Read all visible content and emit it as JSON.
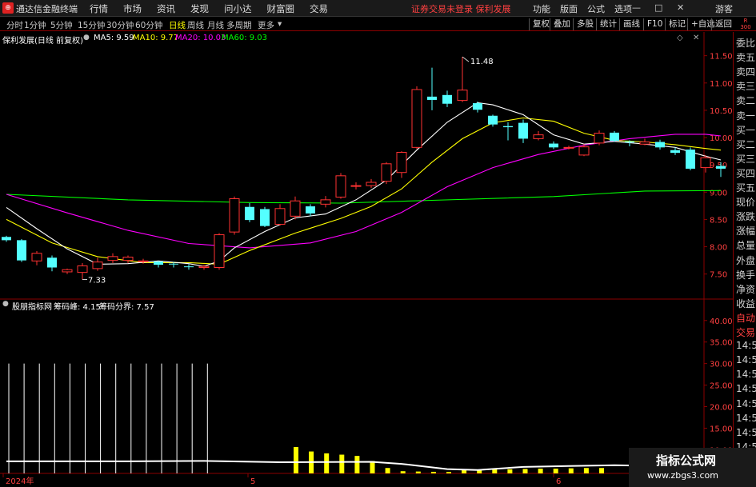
{
  "app": {
    "logo": "⊕",
    "title": "通达信金融终端",
    "menu": [
      "行情",
      "市场",
      "资讯",
      "发现",
      "问小达",
      "财富圈",
      "交易"
    ],
    "warning": "证券交易未登录  保利发展",
    "right_menu": [
      "功能",
      "版面",
      "公式",
      "选项"
    ],
    "window_buttons": [
      "—",
      "□",
      "✕"
    ],
    "user": "游客"
  },
  "periods": {
    "items": [
      "分时",
      "1分钟",
      "5分钟",
      "15分钟",
      "30分钟",
      "60分钟",
      "日线",
      "周线",
      "月线",
      "多周期",
      "更多"
    ],
    "active": "日线",
    "tools": [
      "复权",
      "叠加",
      "多股",
      "统计",
      "画线",
      "F10",
      "标记",
      "+自选",
      "返回"
    ],
    "badge_top": "R",
    "badge_bottom": "300"
  },
  "main_info": {
    "title": "保利发展(日线 前复权)",
    "ma5": "MA5: 9.59",
    "ma10": "MA10: 9.77",
    "ma20": "MA20: 10.03",
    "ma60": "MA60: 9.03"
  },
  "sub_info": {
    "title": "股朋指标网",
    "peak": "筹码峰: 4.15",
    "boundary": "筹码分界: 7.57"
  },
  "side_panel": [
    "委比",
    "卖五",
    "卖四",
    "卖三",
    "卖二",
    "卖一",
    "买一",
    "买二",
    "买三",
    "买四",
    "买五",
    "现价",
    "涨跌",
    "涨幅",
    "总量",
    "外盘",
    "换手",
    "净资",
    "收益",
    "自动",
    "交易",
    "14:5",
    "14:5",
    "14:5",
    "14:5",
    "14:5",
    "14:5",
    "14:5",
    "14:5",
    "14:5"
  ],
  "watermark": {
    "line1": "指标公式网",
    "line2": "www.zbgs3.com"
  },
  "colors": {
    "up": "#ff3232",
    "down": "#54ffff",
    "ma5": "#ffffff",
    "ma10": "#ffff00",
    "ma20": "#ff00ff",
    "ma60": "#00ff00",
    "axis": "#8b0000",
    "warning": "#ff4040"
  },
  "chart_data": [
    {
      "type": "candlestick",
      "title": "保利发展(日线 前复权)",
      "y_ticks": [
        "11.50",
        "11.00",
        "10.50",
        "10.00",
        "9.50",
        "9.00",
        "8.50",
        "8.00",
        "7.50"
      ],
      "ylim": [
        7.1,
        11.7
      ],
      "x_labels": [
        "2024年",
        "5",
        "6"
      ],
      "annotations": [
        "11.48",
        "7.33"
      ],
      "candles": [
        [
          8.18,
          8.12,
          8.2,
          8.09
        ],
        [
          8.12,
          7.75,
          8.14,
          7.72
        ],
        [
          7.74,
          7.88,
          7.92,
          7.66
        ],
        [
          7.8,
          7.62,
          7.84,
          7.55
        ],
        [
          7.54,
          7.58,
          7.6,
          7.5
        ],
        [
          7.53,
          7.65,
          7.7,
          7.4
        ],
        [
          7.6,
          7.72,
          7.8,
          7.56
        ],
        [
          7.75,
          7.82,
          7.88,
          7.7
        ],
        [
          7.75,
          7.81,
          7.84,
          7.7
        ],
        [
          7.73,
          7.74,
          7.78,
          7.69
        ],
        [
          7.73,
          7.67,
          7.74,
          7.62
        ],
        [
          7.69,
          7.68,
          7.72,
          7.62
        ],
        [
          7.64,
          7.63,
          7.68,
          7.58
        ],
        [
          7.62,
          7.64,
          7.67,
          7.58
        ],
        [
          7.62,
          8.22,
          8.25,
          7.58
        ],
        [
          8.27,
          8.88,
          8.92,
          8.22
        ],
        [
          8.73,
          8.49,
          8.8,
          8.45
        ],
        [
          8.69,
          8.38,
          8.73,
          8.36
        ],
        [
          8.41,
          8.7,
          8.78,
          8.39
        ],
        [
          8.56,
          8.84,
          8.92,
          8.5
        ],
        [
          8.74,
          8.61,
          8.78,
          8.56
        ],
        [
          8.78,
          8.86,
          8.93,
          8.72
        ],
        [
          8.91,
          9.3,
          9.35,
          8.88
        ],
        [
          9.11,
          9.12,
          9.18,
          9.05
        ],
        [
          9.12,
          9.18,
          9.24,
          9.08
        ],
        [
          9.2,
          9.52,
          9.55,
          9.15
        ],
        [
          9.36,
          9.73,
          9.75,
          9.26
        ],
        [
          9.82,
          10.88,
          10.94,
          9.79
        ],
        [
          10.75,
          10.69,
          11.28,
          10.5
        ],
        [
          10.78,
          10.62,
          10.86,
          10.56
        ],
        [
          10.68,
          10.87,
          11.48,
          10.65
        ],
        [
          10.63,
          10.51,
          10.66,
          10.46
        ],
        [
          10.4,
          10.24,
          10.42,
          10.2
        ],
        [
          10.21,
          10.19,
          10.28,
          9.95
        ],
        [
          10.27,
          9.98,
          10.33,
          9.9
        ],
        [
          9.98,
          10.05,
          10.12,
          9.95
        ],
        [
          9.89,
          9.82,
          9.93,
          9.79
        ],
        [
          9.82,
          9.82,
          9.85,
          9.78
        ],
        [
          9.68,
          9.83,
          9.88,
          9.66
        ],
        [
          9.9,
          10.08,
          10.13,
          9.86
        ],
        [
          10.09,
          9.94,
          10.12,
          9.92
        ],
        [
          9.93,
          9.91,
          9.95,
          9.84
        ],
        [
          9.88,
          9.92,
          9.98,
          9.86
        ],
        [
          9.92,
          9.82,
          9.96,
          9.78
        ],
        [
          9.77,
          9.72,
          9.82,
          9.68
        ],
        [
          9.78,
          9.43,
          9.82,
          9.4
        ],
        [
          9.45,
          9.63,
          9.68,
          9.36
        ],
        [
          9.48,
          9.43,
          9.55,
          9.28
        ]
      ],
      "ma5": [
        [
          0,
          8.72
        ],
        [
          2,
          8.33
        ],
        [
          4,
          7.96
        ],
        [
          6,
          7.68
        ],
        [
          8,
          7.69
        ],
        [
          10,
          7.74
        ],
        [
          12,
          7.69
        ],
        [
          13,
          7.64
        ],
        [
          14,
          7.74
        ],
        [
          15,
          7.98
        ],
        [
          17,
          8.28
        ],
        [
          19,
          8.53
        ],
        [
          21,
          8.6
        ],
        [
          23,
          8.86
        ],
        [
          25,
          9.22
        ],
        [
          27,
          9.77
        ],
        [
          29,
          10.28
        ],
        [
          31,
          10.64
        ],
        [
          32,
          10.6
        ],
        [
          34,
          10.42
        ],
        [
          36,
          10.05
        ],
        [
          38,
          9.88
        ],
        [
          40,
          9.93
        ],
        [
          42,
          9.88
        ],
        [
          44,
          9.82
        ],
        [
          46,
          9.66
        ],
        [
          47,
          9.59
        ]
      ],
      "ma10": [
        [
          0,
          8.5
        ],
        [
          3,
          8.07
        ],
        [
          6,
          7.82
        ],
        [
          9,
          7.71
        ],
        [
          12,
          7.71
        ],
        [
          14,
          7.68
        ],
        [
          16,
          7.93
        ],
        [
          19,
          8.25
        ],
        [
          22,
          8.52
        ],
        [
          24,
          8.74
        ],
        [
          26,
          9.06
        ],
        [
          28,
          9.55
        ],
        [
          30,
          9.98
        ],
        [
          32,
          10.27
        ],
        [
          34,
          10.36
        ],
        [
          36,
          10.3
        ],
        [
          38,
          10.08
        ],
        [
          40,
          9.95
        ],
        [
          42,
          9.92
        ],
        [
          44,
          9.87
        ],
        [
          46,
          9.8
        ],
        [
          47,
          9.77
        ]
      ],
      "ma20": [
        [
          0,
          8.96
        ],
        [
          4,
          8.62
        ],
        [
          8,
          8.3
        ],
        [
          12,
          8.06
        ],
        [
          16,
          7.98
        ],
        [
          20,
          8.07
        ],
        [
          23,
          8.28
        ],
        [
          26,
          8.63
        ],
        [
          29,
          9.1
        ],
        [
          32,
          9.45
        ],
        [
          35,
          9.69
        ],
        [
          38,
          9.86
        ],
        [
          41,
          9.98
        ],
        [
          44,
          10.06
        ],
        [
          46,
          10.06
        ],
        [
          47,
          10.03
        ]
      ],
      "ma60": [
        [
          0,
          8.96
        ],
        [
          8,
          8.86
        ],
        [
          16,
          8.81
        ],
        [
          22,
          8.8
        ],
        [
          28,
          8.85
        ],
        [
          36,
          8.92
        ],
        [
          42,
          9.02
        ],
        [
          47,
          9.03
        ]
      ]
    },
    {
      "type": "bar",
      "title": "股朋指标网",
      "y_ticks": [
        "40.00",
        "35.00",
        "30.00",
        "25.00",
        "20.00",
        "15.00",
        "10.00"
      ],
      "ylim": [
        4.5,
        42
      ],
      "white_bars": [
        30,
        30,
        30,
        30,
        30,
        30,
        30,
        30,
        30,
        30,
        30,
        30,
        30,
        30
      ],
      "yellow_bars": [
        4.15,
        3.45,
        3.15,
        2.95,
        2.75,
        1.95,
        0.85,
        0.35,
        0.3,
        0.25,
        0.22,
        0.55,
        0.6,
        0.65,
        0.65,
        0.7,
        0.75,
        0.75,
        0.8,
        0.85,
        0.85
      ],
      "white_line": [
        [
          0,
          7.3
        ],
        [
          8,
          7.3
        ],
        [
          13,
          7.4
        ],
        [
          18,
          7.1
        ],
        [
          24,
          7.2
        ],
        [
          26,
          6.7
        ],
        [
          29,
          5.5
        ],
        [
          31,
          5.3
        ],
        [
          34,
          6.0
        ],
        [
          37,
          6.2
        ],
        [
          40,
          6.4
        ],
        [
          43,
          6.2
        ],
        [
          45,
          6.7
        ],
        [
          47,
          7.0
        ]
      ]
    }
  ]
}
